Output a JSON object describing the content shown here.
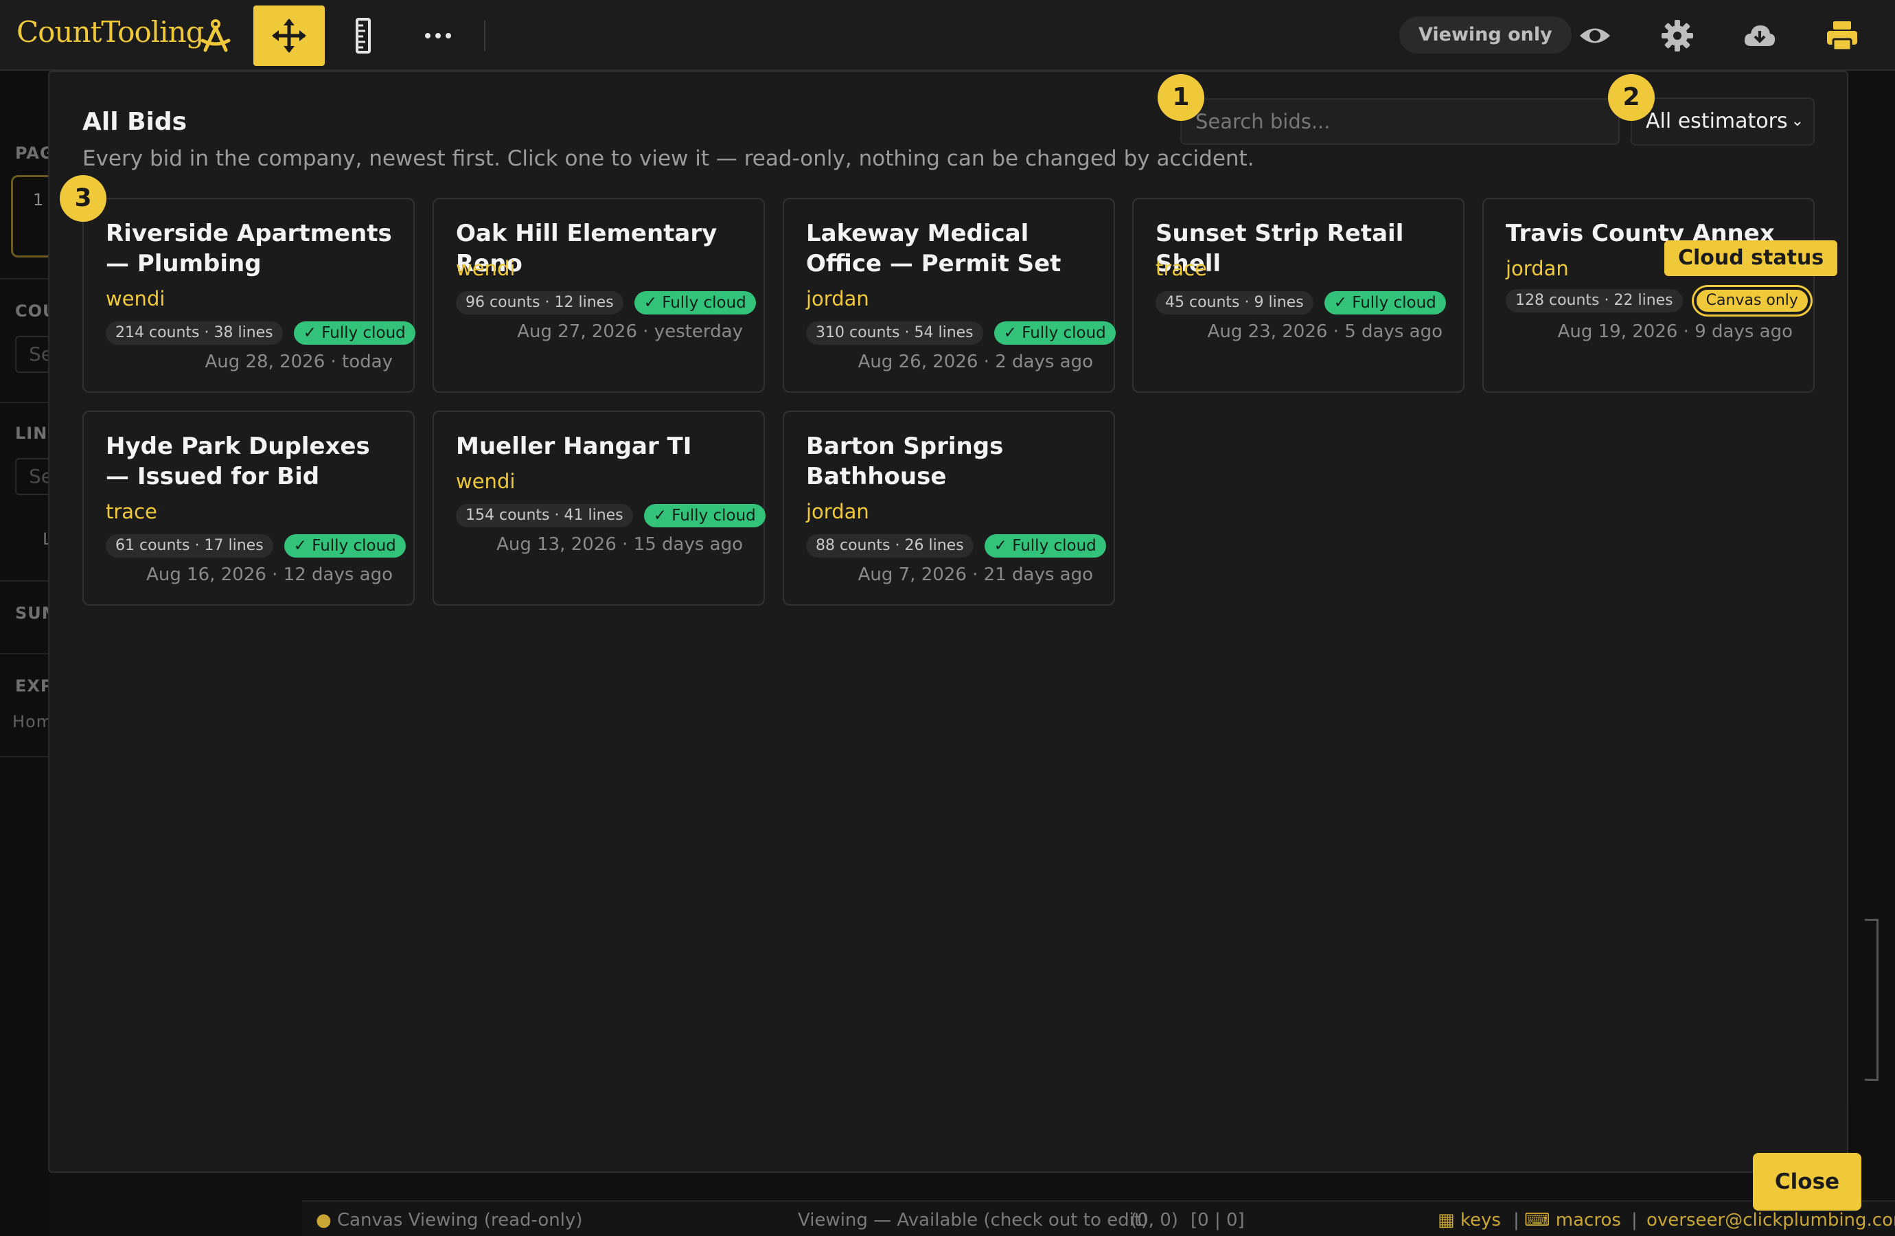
{
  "app": {
    "logo": "CountTooling",
    "viewing_pill": "Viewing only"
  },
  "toolbar": {
    "tools": [
      "compass-tool-icon",
      "move-tool-icon",
      "ruler-tool-icon",
      "more-icon"
    ],
    "right_icons": [
      "eye-icon",
      "gear-icon",
      "cloud-download-icon",
      "print-icon"
    ],
    "accent": "#f0c93b"
  },
  "background": {
    "side_labels": [
      "PAG",
      "COU",
      "LINE",
      "SUM",
      "EXP"
    ],
    "page_number": "1",
    "side_inputs": [
      "Se",
      "Se"
    ],
    "side_l": "L",
    "side_home": "Hom"
  },
  "modal": {
    "title": "All Bids",
    "subtitle": "Every bid in the company, newest first. Click one to view it — read-only, nothing can be changed by accident.",
    "search_placeholder": "Search bids...",
    "estimator_filter": "All estimators",
    "step_badges": [
      "1",
      "2",
      "3"
    ],
    "tooltip": "Cloud status",
    "close_label": "Close"
  },
  "bids": [
    {
      "title": "Riverside Apartments — Plumbing",
      "estimator": "wendi",
      "counts": "214 counts · 38 lines",
      "status": "✓ Fully cloud",
      "date": "Aug 28, 2026 · today"
    },
    {
      "title": "Oak Hill Elementary Reno",
      "estimator": "wendi",
      "counts": "96 counts · 12 lines",
      "status": "✓ Fully cloud",
      "date": "Aug 27, 2026 · yesterday"
    },
    {
      "title": "Lakeway Medical Office — Permit Set",
      "estimator": "jordan",
      "counts": "310 counts · 54 lines",
      "status": "✓ Fully cloud",
      "date": "Aug 26, 2026 · 2 days ago"
    },
    {
      "title": "Sunset Strip Retail Shell",
      "estimator": "trace",
      "counts": "45 counts · 9 lines",
      "status": "✓ Fully cloud",
      "date": "Aug 23, 2026 · 5 days ago"
    },
    {
      "title": "Travis County Annex",
      "estimator": "jordan",
      "counts": "128 counts · 22 lines",
      "status": "Canvas only",
      "date": "Aug 19, 2026 · 9 days ago"
    },
    {
      "title": "Hyde Park Duplexes — Issued for Bid",
      "estimator": "trace",
      "counts": "61 counts · 17 lines",
      "status": "✓ Fully cloud",
      "date": "Aug 16, 2026 · 12 days ago"
    },
    {
      "title": "Mueller Hangar TI",
      "estimator": "wendi",
      "counts": "154 counts · 41 lines",
      "status": "✓ Fully cloud",
      "date": "Aug 13, 2026 · 15 days ago"
    },
    {
      "title": "Barton Springs Bathhouse",
      "estimator": "jordan",
      "counts": "88 counts · 26 lines",
      "status": "✓ Fully cloud",
      "date": "Aug 7, 2026 · 21 days ago"
    }
  ],
  "status_bar": {
    "mode": "Canvas Viewing (read-only)",
    "availability": "Viewing — Available (check out to edit)",
    "coords": "(0, 0)",
    "grid": "[0 | 0]",
    "keys": "keys",
    "macros": "macros",
    "user": "overseer@clickplumbing.com"
  }
}
